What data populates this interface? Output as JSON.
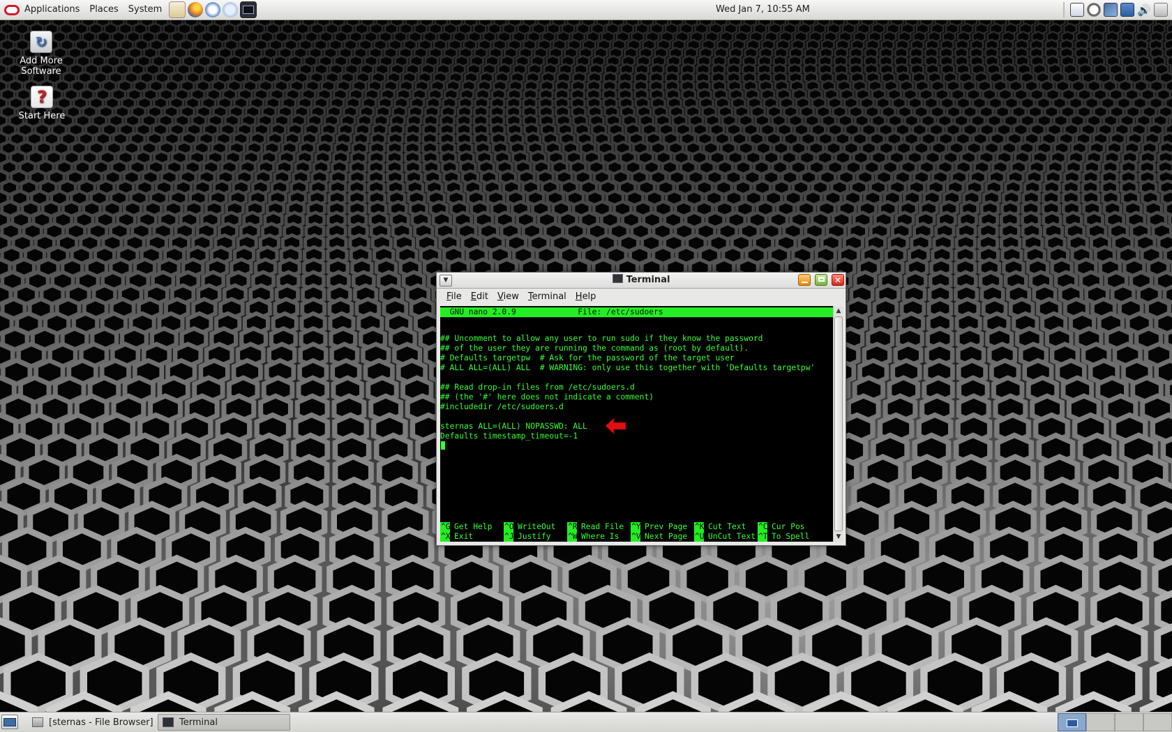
{
  "top_panel": {
    "menus": [
      "Applications",
      "Places",
      "System"
    ],
    "launchers": [
      "home-icon",
      "firefox-icon",
      "mail-icon",
      "update-icon",
      "terminal-icon"
    ],
    "clock": "Wed Jan  7, 10:55 AM",
    "tray_icons": [
      "system-monitor-icon",
      "clock-icon",
      "network-icon",
      "accessibility-icon",
      "volume-icon",
      "power-icon"
    ]
  },
  "desktop": {
    "icons": [
      {
        "label_line1": "Add More",
        "label_line2": "Software",
        "icon": "software-update-icon"
      },
      {
        "label_line1": "Start Here",
        "label_line2": "",
        "icon": "help-icon"
      }
    ]
  },
  "terminal_window": {
    "title": "Terminal",
    "menu": [
      {
        "label": "File",
        "accel": "F",
        "rest": "ile"
      },
      {
        "label": "Edit",
        "accel": "E",
        "rest": "dit"
      },
      {
        "label": "View",
        "accel": "V",
        "rest": "iew"
      },
      {
        "label": "Terminal",
        "accel": "T",
        "rest": "erminal"
      },
      {
        "label": "Help",
        "accel": "H",
        "rest": "elp"
      }
    ],
    "nano": {
      "header": "  GNU nano 2.0.9             File: /etc/sudoers",
      "lines": [
        "## Uncomment to allow any user to run sudo if they know the password",
        "## of the user they are running the command as (root by default).",
        "# Defaults targetpw  # Ask for the password of the target user",
        "# ALL ALL=(ALL) ALL  # WARNING: only use this together with 'Defaults targetpw'",
        "",
        "## Read drop-in files from /etc/sudoers.d",
        "## (the '#' here does not indicate a comment)",
        "#includedir /etc/sudoers.d",
        "",
        "sternas ALL=(ALL) NOPASSWD: ALL",
        "Defaults timestamp_timeout=-1"
      ],
      "shortcuts_row1": [
        {
          "key": "^G",
          "label": "Get Help"
        },
        {
          "key": "^O",
          "label": "WriteOut"
        },
        {
          "key": "^R",
          "label": "Read File"
        },
        {
          "key": "^Y",
          "label": "Prev Page"
        },
        {
          "key": "^K",
          "label": "Cut Text"
        },
        {
          "key": "^C",
          "label": "Cur Pos"
        }
      ],
      "shortcuts_row2": [
        {
          "key": "^X",
          "label": "Exit"
        },
        {
          "key": "^J",
          "label": "Justify"
        },
        {
          "key": "^W",
          "label": "Where Is"
        },
        {
          "key": "^V",
          "label": "Next Page"
        },
        {
          "key": "^U",
          "label": "UnCut Text"
        },
        {
          "key": "^T",
          "label": "To Spell"
        }
      ]
    }
  },
  "taskbar": {
    "tasks": [
      {
        "label": "[sternas - File Browser]",
        "icon": "file-browser-icon",
        "active": false
      },
      {
        "label": "Terminal",
        "icon": "terminal-icon",
        "active": true
      }
    ],
    "workspaces": 4,
    "active_workspace": 1
  },
  "colors": {
    "terminal_text": "#33ff33",
    "nano_bar": "#22ee22",
    "annotation_arrow": "#e01010"
  }
}
